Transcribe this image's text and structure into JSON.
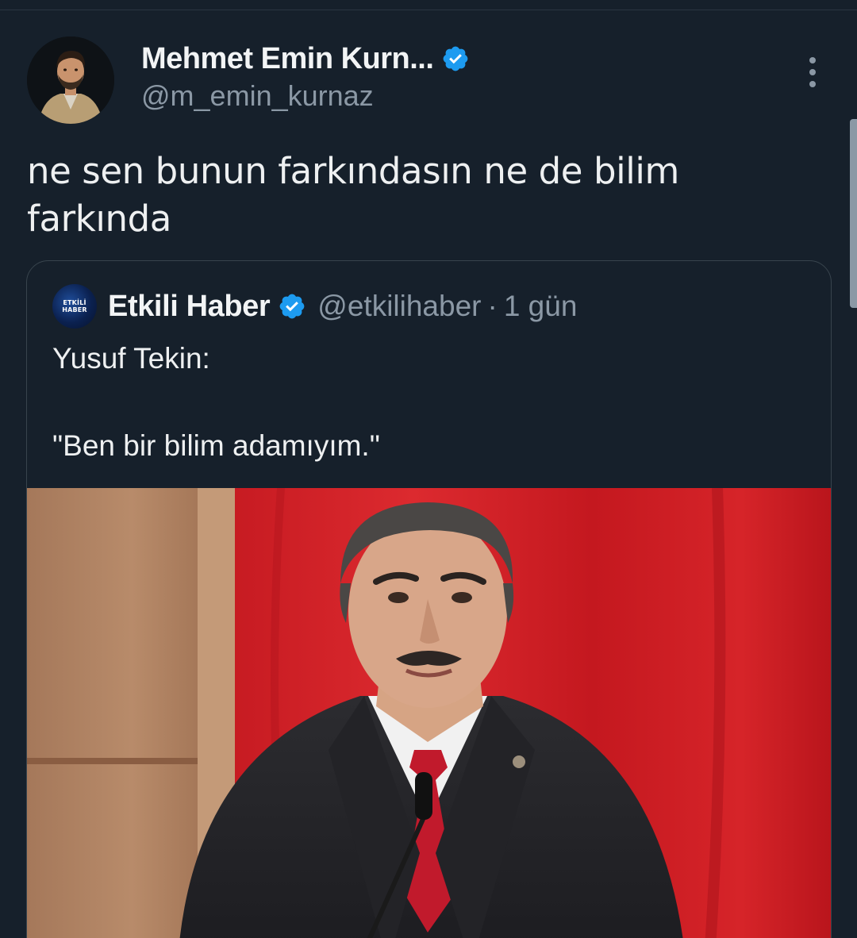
{
  "tweet": {
    "author_name": "Mehmet Emin Kurn...",
    "author_handle": "@m_emin_kurnaz",
    "verified_icon": "verified-badge-icon",
    "more_icon": "more-options-icon",
    "text": "ne sen bunun farkındasın ne de bilim farkında"
  },
  "quoted_tweet": {
    "logo_text_line1": "ETKİLİ",
    "logo_text_line2": "HABER",
    "author_name": "Etkili Haber",
    "author_handle": "@etkilihaber",
    "separator": "·",
    "time": "1 gün",
    "text_line1": "Yusuf Tekin:",
    "text_line2": "\"Ben bir bilim adamıyım.\""
  },
  "colors": {
    "background": "#16202b",
    "text_primary": "#eef0f1",
    "text_secondary": "#8b98a5",
    "verified": "#1d9bf0",
    "card_border": "#38444d",
    "flag_red": "#d0212a"
  }
}
